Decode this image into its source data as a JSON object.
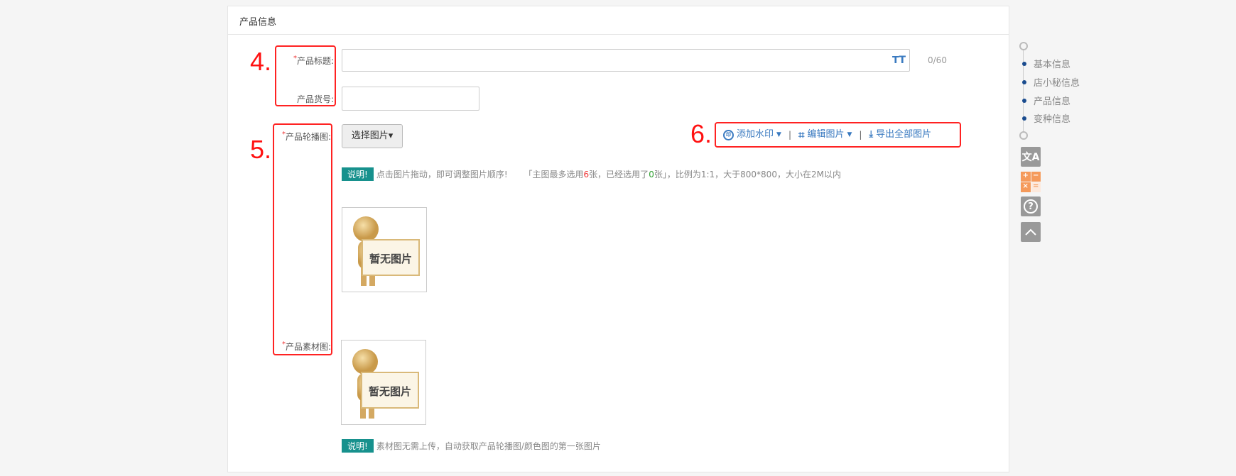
{
  "panel": {
    "title": "产品信息"
  },
  "annotations": {
    "n4": "4.",
    "n5": "5.",
    "n6": "6."
  },
  "form": {
    "title_label": "产品标题:",
    "title_value": "",
    "title_counter": "0/60",
    "title_icon": "text-size-icon",
    "sku_label": "产品货号:",
    "sku_value": "",
    "carousel_label": "产品轮播图:",
    "choose_button": "选择图片▾",
    "toolbar": {
      "watermark": "添加水印",
      "edit": "编辑图片",
      "export": "导出全部图片",
      "sep": "|"
    },
    "note1": {
      "badge": "说明!",
      "text": "点击图片拖动，即可调整图片顺序!",
      "rule_pre": "「主图最多选用",
      "max": "6",
      "rule_mid": "张，已经选用了",
      "used": "0",
      "rule_post": "张」，比例为1:1，大于800*800，大小在2M以内"
    },
    "placeholder_text": "暂无图片",
    "material_label": "产品素材图:",
    "note2": {
      "badge": "说明!",
      "text": "素材图无需上传，自动获取产品轮播图/颜色图的第一张图片"
    }
  },
  "sidebar": {
    "items": [
      "基本信息",
      "店小秘信息",
      "产品信息",
      "变种信息"
    ]
  },
  "colors": {
    "accent": "#3a7ac0",
    "annotation": "#ff2222",
    "badge": "#17918d",
    "max": "#e33333",
    "used": "#2e9e2e"
  }
}
